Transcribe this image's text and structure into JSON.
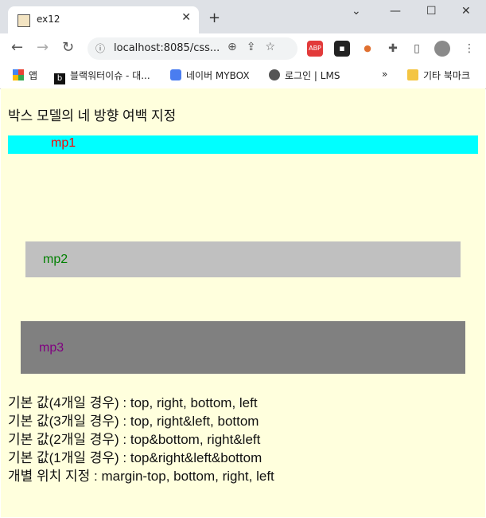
{
  "browser": {
    "tab_title": "ex12",
    "url": "localhost:8085/css...",
    "bookmarks": [
      "앱",
      "블랙워터이슈 - 대...",
      "네이버 MYBOX",
      "로그인 | LMS",
      "기타 북마크"
    ]
  },
  "page": {
    "heading": "박스 모델의 네 방향 여백 지정",
    "boxes": [
      {
        "label": "mp1"
      },
      {
        "label": "mp2"
      },
      {
        "label": "mp3"
      }
    ],
    "notes": [
      "기본 값(4개일 경우) : top, right, bottom, left",
      "기본 값(3개일 경우) : top, right&left, bottom",
      "기본 값(2개일 경우) : top&bottom, right&left",
      "기본 값(1개일 경우) : top&right&left&bottom",
      "개별 위치 지정 : margin-top, bottom, right, left"
    ]
  },
  "colors": {
    "page_bg": "#ffffdd",
    "mp1_bg": "#00ffff",
    "mp1_text": "#ff0000",
    "mp2_bg": "#c0c0c0",
    "mp2_text": "#008000",
    "mp3_bg": "#808080",
    "mp3_text": "#800080"
  },
  "icons": [
    "favicon",
    "close-icon",
    "new-tab-icon",
    "back-icon",
    "forward-icon",
    "reload-icon",
    "info-icon",
    "zoom-icon",
    "share-icon",
    "star-icon",
    "adblock-icon",
    "extensions-icon",
    "sidepanel-icon",
    "avatar"
  ]
}
